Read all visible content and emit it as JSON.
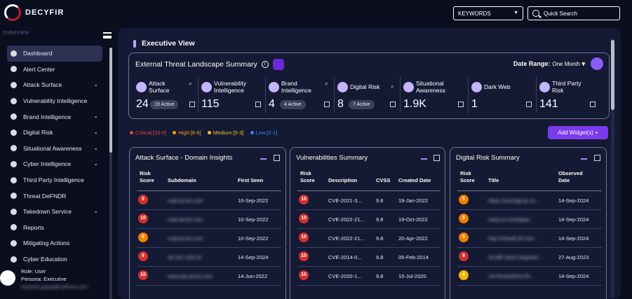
{
  "app": {
    "brand": "DECYFIR",
    "overview_label": "OVERVIEW"
  },
  "search": {
    "keywords_label": "KEYWORDS",
    "placeholder": "Quick Search"
  },
  "sidebar": {
    "items": [
      {
        "label": "Dashboard",
        "icon": "dashboard-icon",
        "active": true,
        "chevron": false
      },
      {
        "label": "Alert Center",
        "icon": "bell-icon",
        "active": false,
        "chevron": false
      },
      {
        "label": "Attack Surface",
        "icon": "globe-icon",
        "active": false,
        "chevron": true
      },
      {
        "label": "Vulnerability Intelligence",
        "icon": "shield-icon",
        "active": false,
        "chevron": false
      },
      {
        "label": "Brand Intelligence",
        "icon": "brand-icon",
        "active": false,
        "chevron": true
      },
      {
        "label": "Digital Risk",
        "icon": "digital-risk-icon",
        "active": false,
        "chevron": true
      },
      {
        "label": "Situational Awareness",
        "icon": "awareness-icon",
        "active": false,
        "chevron": true
      },
      {
        "label": "Cyber Intelligence",
        "icon": "cyber-icon",
        "active": false,
        "chevron": true
      },
      {
        "label": "Third Party Intelligence",
        "icon": "third-party-icon",
        "active": false,
        "chevron": false
      },
      {
        "label": "Threat DeFNDR",
        "icon": "target-icon",
        "active": false,
        "chevron": false
      },
      {
        "label": "Takedown Service",
        "icon": "takedown-icon",
        "active": false,
        "chevron": true
      },
      {
        "label": "Reports",
        "icon": "report-icon",
        "active": false,
        "chevron": false
      },
      {
        "label": "Mitigating Actions",
        "icon": "mitigation-icon",
        "active": false,
        "chevron": false
      },
      {
        "label": "Cyber Education",
        "icon": "education-icon",
        "active": false,
        "chevron": false
      }
    ]
  },
  "user": {
    "role": "Role: User",
    "persona": "Persona: Executive",
    "email": "santosh.gupta@cyfirma.com"
  },
  "main": {
    "view_title": "Executive View",
    "landscape": {
      "title": "External Threat Landscape Summary",
      "date_range_label": "Date Range:",
      "date_range_value": "One Month",
      "metrics": [
        {
          "label1": "Attack",
          "label2": "Surface",
          "value": "24",
          "badge": "19 Active",
          "zoom": true
        },
        {
          "label1": "Vulnerability",
          "label2": "Intelligence",
          "value": "115",
          "badge": "",
          "zoom": false
        },
        {
          "label1": "Brand",
          "label2": "Intelligence",
          "value": "4",
          "badge": "4 Active",
          "zoom": true
        },
        {
          "label1": "Digital Risk",
          "label2": "",
          "value": "8",
          "badge": "7 Active",
          "zoom": true
        },
        {
          "label1": "Situational",
          "label2": "Awareness",
          "value": "1.9K",
          "badge": "",
          "zoom": false
        },
        {
          "label1": "Dark Web",
          "label2": "",
          "value": "1",
          "badge": "",
          "zoom": false
        },
        {
          "label1": "Third Party",
          "label2": "Risk",
          "value": "141",
          "badge": "",
          "zoom": false
        }
      ]
    },
    "legend": [
      {
        "label": "Critical:[10-9]",
        "color": "#e0463a"
      },
      {
        "label": "High:[8-6]",
        "color": "#f59e0b"
      },
      {
        "label": "Medium:[5-3]",
        "color": "#fbbf24"
      },
      {
        "label": "Low:[2-1]",
        "color": "#3b82f6"
      }
    ],
    "add_widget_label": "Add Widget(s) +",
    "cards": [
      {
        "title": "Attack Surface - Domain Insights",
        "headers": [
          "Risk\nScore",
          "Subdomain",
          "First Seen"
        ],
        "rows": [
          {
            "score": "9",
            "color": "#d32f2f",
            "c1": "mail.acme.com",
            "c2": "10-Sep-2022"
          },
          {
            "score": "10",
            "color": "#d32f2f",
            "c1": "mail.acme.com",
            "c2": "10-Sep-2022"
          },
          {
            "score": "8",
            "color": "#f57c00",
            "c1": "mail.acme.com",
            "c2": "10-Sep-2022"
          },
          {
            "score": "9",
            "color": "#d32f2f",
            "c1": "54.151.153.24",
            "c2": "14-Sep-2024"
          },
          {
            "score": "10",
            "color": "#d32f2f",
            "c1": "www.pls.acme.com",
            "c2": "14-Jun-2022"
          }
        ]
      },
      {
        "title": "Vulnerabilities Summary",
        "headers": [
          "Risk\nScore",
          "Description",
          "CVSS",
          "Created Date"
        ],
        "rows": [
          {
            "score": "10",
            "color": "#d32f2f",
            "c1": "CVE-2021-3...",
            "c2": "9.8",
            "c3": "19-Jan-2022"
          },
          {
            "score": "10",
            "color": "#d32f2f",
            "c1": "CVE-2022-21...",
            "c2": "9.8",
            "c3": "19-Oct-2022"
          },
          {
            "score": "10",
            "color": "#d32f2f",
            "c1": "CVE-2022-21...",
            "c2": "9.8",
            "c3": "20-Apr-2022"
          },
          {
            "score": "10",
            "color": "#d32f2f",
            "c1": "CVE-2014-0...",
            "c2": "9.8",
            "c3": "05-Feb-2014"
          },
          {
            "score": "10",
            "color": "#d32f2f",
            "c1": "CVE-2020-1...",
            "c2": "9.8",
            "c3": "15-Jul-2020"
          }
        ]
      },
      {
        "title": "Digital Risk Summary",
        "headers": [
          "Risk\nScore",
          "Title",
          "Observed\nDate"
        ],
        "rows": [
          {
            "score": "5",
            "color": "#f57c00",
            "c1": "https://socialgrep.co...",
            "c2": "14-Sep-2024"
          },
          {
            "score": "5",
            "color": "#f57c00",
            "c1": "www.ss-mediapla...",
            "c2": "14-Sep-2024"
          },
          {
            "score": "5",
            "color": "#f57c00",
            "c1": "http://infweb.lfo.hoo...",
            "c2": "14-Sep-2024"
          },
          {
            "score": "9",
            "color": "#d32f2f",
            "c1": "ACME Bank targeted ...",
            "c2": "27-Aug-2023"
          },
          {
            "score": "4",
            "color": "#f5b400",
            "c1": "VirsTeched/VirsTe...",
            "c2": "14-Sep-2024"
          }
        ]
      }
    ]
  }
}
